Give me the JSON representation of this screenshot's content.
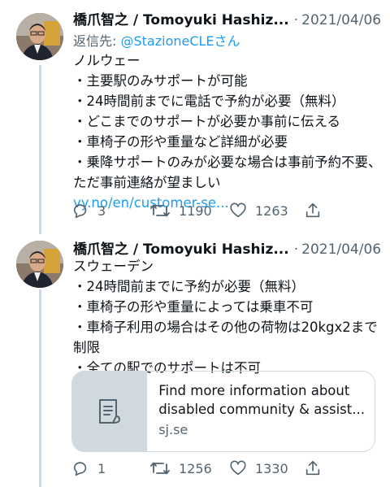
{
  "tweets": [
    {
      "author": "橋爪智之 / Tomoyuki Hashiz...",
      "separator": "·",
      "date": "2021/04/06",
      "reply_prefix": "返信先: ",
      "reply_mention": "@StazioneCLEさん",
      "lines": [
        "ノルウェー",
        "・主要駅のみサポートが可能",
        "・24時間前までに電話で予約が必要（無料）",
        "・どこまでのサポートが必要か事前に伝える",
        "・車椅子の形や重量など詳細が必要",
        "・乗降サポートのみが必要な場合は事前予約不要、",
        "ただ事前連絡が望ましい"
      ],
      "link": "vy.no/en/customer-se...",
      "replies": "3",
      "retweets": "1190",
      "likes": "1263"
    },
    {
      "author": "橋爪智之 / Tomoyuki Hashiz...",
      "separator": "·",
      "date": "2021/04/06",
      "lines": [
        "スウェーデン",
        "・24時間前までに予約が必要（無料）",
        "・車椅子の形や重量によっては乗車不可",
        "・車椅子利用の場合はその他の荷物は20kgx2まで",
        "制限",
        "・全ての駅でのサポートは不可"
      ],
      "card": {
        "title_line1": "Find more information about",
        "title_line2": "disabled community & assist...",
        "domain": "sj.se"
      },
      "replies": "1",
      "retweets": "1256",
      "likes": "1330"
    }
  ],
  "icons": {
    "reply": "speech-bubble-icon",
    "retweet": "retweet-arrows-icon",
    "like": "heart-icon",
    "share": "share-upload-icon",
    "card_thumb": "document-icon"
  },
  "colors": {
    "link": "#1d9bf0",
    "secondary_text": "#536471",
    "thread_line": "#cfd9de"
  }
}
